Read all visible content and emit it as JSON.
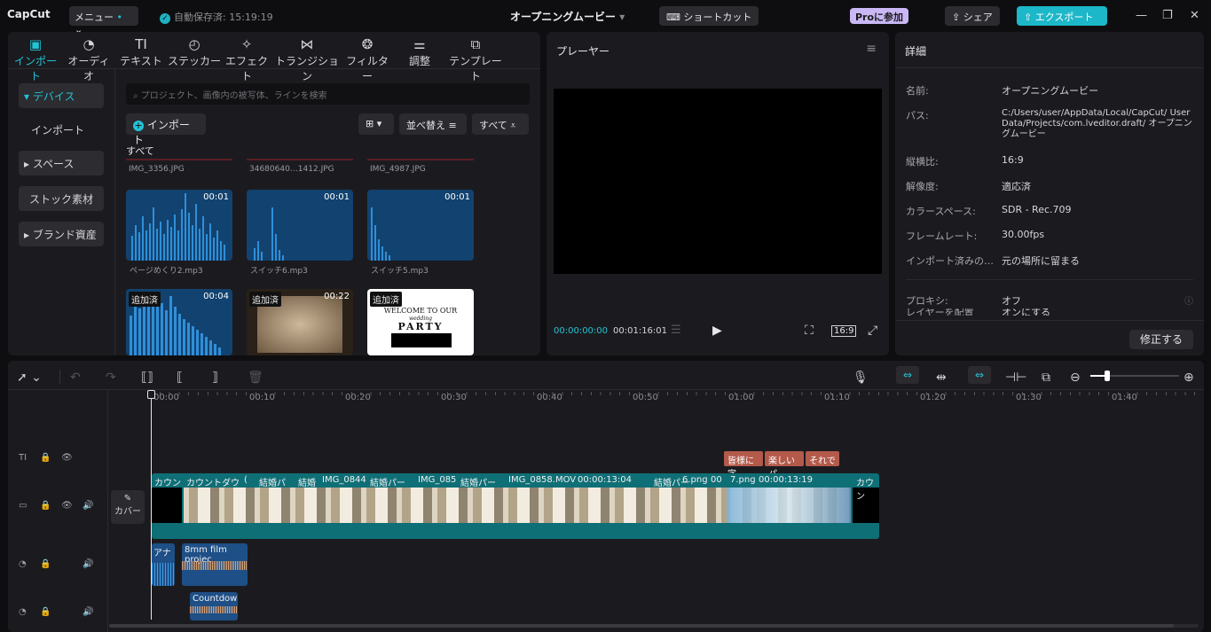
{
  "titlebar": {
    "logo": "CapCut",
    "menu": "メニュー",
    "autosave": "自動保存済: 15:19:19",
    "project_title": "オープニングムービー",
    "shortcut": "ショートカット",
    "pro": "Proに参加",
    "share": "シェア",
    "export": "エクスポート"
  },
  "media": {
    "tabs": [
      {
        "label": "インポート",
        "icon": "import-icon"
      },
      {
        "label": "オーディオ",
        "icon": "audio-icon"
      },
      {
        "label": "テキスト",
        "icon": "text-icon"
      },
      {
        "label": "ステッカー",
        "icon": "sticker-icon"
      },
      {
        "label": "エフェクト",
        "icon": "effect-icon"
      },
      {
        "label": "トランジション",
        "icon": "transition-icon"
      },
      {
        "label": "フィルター",
        "icon": "filter-icon"
      },
      {
        "label": "調整",
        "icon": "adjust-icon"
      },
      {
        "label": "テンプレート",
        "icon": "template-icon"
      }
    ],
    "categories": [
      "デバイス",
      "インポート",
      "スペース",
      "ストック素材",
      "ブランド資産"
    ],
    "search_placeholder": "プロジェクト、画像内の被写体、ラインを検索",
    "import_button": "インポート",
    "sort_button": "並べ替え",
    "filter_button": "すべて",
    "section_label": "すべて",
    "row1_names": [
      "IMG_3356.JPG",
      "34680640…1412.JPG",
      "IMG_4987.JPG"
    ],
    "audio_items": [
      {
        "name": "ページめくり2.mp3",
        "duration": "00:01"
      },
      {
        "name": "スイッチ6.mp3",
        "duration": "00:01"
      },
      {
        "name": "スイッチ5.mp3",
        "duration": "00:01"
      }
    ],
    "row3": [
      {
        "badge": "追加済",
        "duration": "00:04"
      },
      {
        "badge": "追加済",
        "duration": "00:22"
      },
      {
        "badge": "追加済",
        "duration": ""
      }
    ],
    "party_card": {
      "line1": "WELCOME TO OUR",
      "line2": "wedding",
      "line3": "PARTY"
    }
  },
  "player": {
    "title": "プレーヤー",
    "current_time": "00:00:00:00",
    "total_time": "00:01:16:01",
    "ratio": "16:9"
  },
  "detail": {
    "title": "詳細",
    "rows": [
      {
        "label": "名前:",
        "value": "オープニングムービー"
      },
      {
        "label": "パス:",
        "value": "C:/Users/user/AppData/Local/CapCut/ User Data/Projects/com.lveditor.draft/ オープニングムービー"
      },
      {
        "label": "縦横比:",
        "value": "16:9"
      },
      {
        "label": "解像度:",
        "value": "適応済"
      },
      {
        "label": "カラースペース:",
        "value": "SDR - Rec.709"
      },
      {
        "label": "フレームレート:",
        "value": "30.00fps"
      },
      {
        "label": "インポート済みの…",
        "value": "元の場所に留まる"
      },
      {
        "label": "プロキシ:",
        "value": "オフ"
      },
      {
        "label": "レイヤーを配置",
        "value": "オンにする"
      }
    ],
    "edit_button": "修正する"
  },
  "timeline": {
    "ruler": [
      "00:00",
      "00:10",
      "00:20",
      "00:30",
      "00:40",
      "00:50",
      "01:00",
      "01:10",
      "01:20",
      "01:30",
      "01:40"
    ],
    "cover_label": "カバー",
    "text_clips": [
      "皆様に字",
      "楽しいパ",
      "それで"
    ],
    "video_labels": [
      "カウン",
      "カウントダウ",
      "(",
      "結婚パ",
      "結婚",
      "IMG_0844",
      "結婚パー",
      "IMG_085",
      "結婚パー",
      "IMG_0858.MOV",
      "00:00:13:04",
      "結婚パー",
      "6.png",
      "00",
      "7.png",
      "00:00:13:19",
      "カウン"
    ],
    "audio1_labels": [
      "アナ",
      "8mm film projec"
    ],
    "audio2_labels": [
      "Countdown"
    ]
  }
}
